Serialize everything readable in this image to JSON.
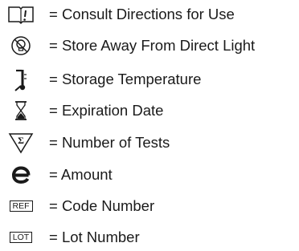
{
  "symbols": [
    {
      "icon": "consult-instructions-icon",
      "label": "= Consult Directions for Use"
    },
    {
      "icon": "keep-away-from-light-icon",
      "label": "= Store Away From Direct Light"
    },
    {
      "icon": "thermometer-icon",
      "label": "= Storage Temperature"
    },
    {
      "icon": "hourglass-icon",
      "label": "= Expiration Date"
    },
    {
      "icon": "sigma-triangle-icon",
      "label": "= Number of Tests"
    },
    {
      "icon": "estimated-e-icon",
      "label": "= Amount"
    },
    {
      "icon": "ref-box-icon",
      "label": "= Code Number",
      "box_text": "REF"
    },
    {
      "icon": "lot-box-icon",
      "label": "= Lot Number",
      "box_text": "LOT"
    }
  ]
}
